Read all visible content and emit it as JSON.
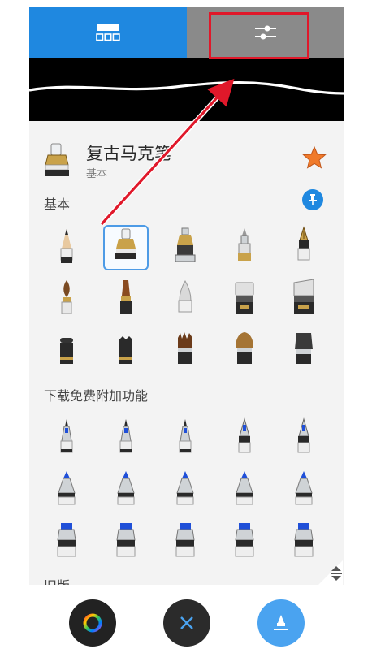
{
  "tabs": [
    {
      "name": "brush-library",
      "icon": "grid-icon",
      "active": true
    },
    {
      "name": "brush-settings",
      "icon": "sliders-icon",
      "active": false
    }
  ],
  "brush": {
    "title": "复古马克笔",
    "subtitle": "基本",
    "favorite": true
  },
  "sections": {
    "basic": "基本",
    "downloads": "下载免费附加功能",
    "legacy": "旧版"
  },
  "colors": {
    "accent_blue": "#1f88e0",
    "tab_inactive": "#8a8a8a",
    "star": "#f07a2a",
    "annotation_red": "#e0182a",
    "fab_brush": "#4aa3f0"
  },
  "basic_brushes": [
    "pencil-icon",
    "vintage-marker-icon",
    "ink-marker-icon",
    "ballpoint-icon",
    "fountain-pen-icon",
    "paint-brush-icon",
    "flat-brush-icon",
    "airbrush-icon",
    "chisel-marker-icon",
    "wide-marker-icon",
    "block-eraser-icon",
    "textured-eraser-icon",
    "splatter-brush-icon",
    "fan-brush-icon",
    "dry-brush-icon"
  ],
  "download_brushes": [
    "fineliner-1-icon",
    "fineliner-2-icon",
    "fineliner-3-icon",
    "nib-pen-1-icon",
    "nib-pen-2-icon",
    "cone-marker-1-icon",
    "cone-marker-2-icon",
    "cone-marker-3-icon",
    "cone-marker-4-icon",
    "cone-marker-5-icon",
    "block-marker-1-icon",
    "block-marker-2-icon",
    "block-marker-3-icon",
    "block-marker-4-icon",
    "block-marker-5-icon"
  ],
  "fabs": [
    "color-wheel-icon",
    "close-icon",
    "brush-icon"
  ]
}
